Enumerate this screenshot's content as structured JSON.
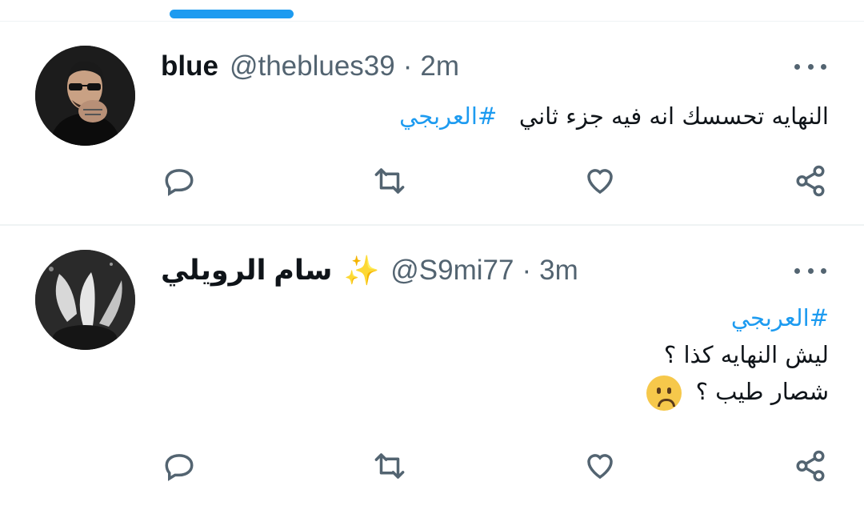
{
  "colors": {
    "accent": "#1d9bf0",
    "muted": "#536471",
    "text": "#0f1419"
  },
  "tweets": [
    {
      "name": "blue",
      "handle": "@theblues39",
      "separator": "·",
      "time": "2m",
      "hashtag": "#العربجي",
      "line1": "النهايه تحسسك انه فيه جزء ثاني",
      "actions": [
        "reply-icon",
        "retweet-icon",
        "like-icon",
        "share-icon"
      ]
    },
    {
      "name": "سام الرويلي",
      "badge_icon": "sparkles-icon",
      "badge": "✨",
      "handle": "@S9mi77",
      "separator": "·",
      "time": "3m",
      "hashtag": "#العربجي",
      "line2": "ليش النهايه كذا ؟",
      "line3": "شصار طيب ؟",
      "emoji_icon": "worried-face-icon",
      "actions": [
        "reply-icon",
        "retweet-icon",
        "like-icon",
        "share-icon"
      ]
    }
  ]
}
